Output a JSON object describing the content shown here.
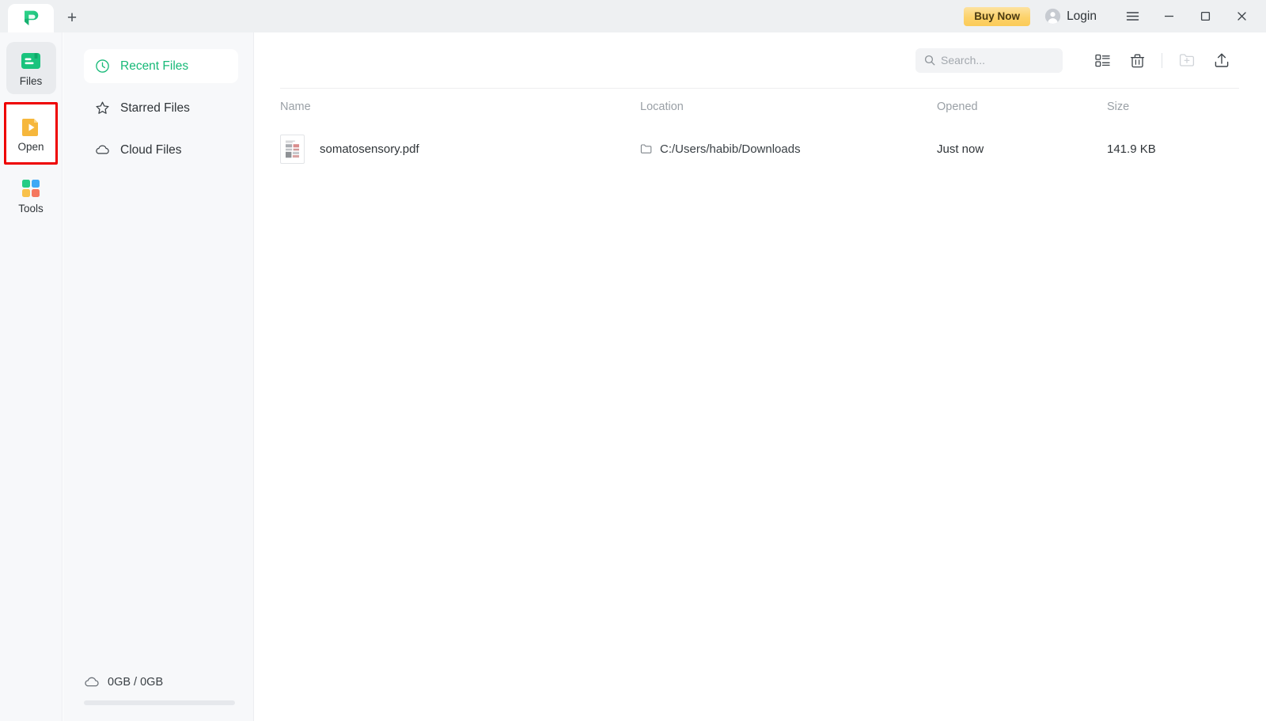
{
  "window": {
    "tab_logo": "pdfelement-logo-icon",
    "new_tab_label": "+",
    "buy_now_label": "Buy Now",
    "login_label": "Login",
    "menu_icon": "hamburger-menu-icon",
    "minimize_icon": "minimize-icon",
    "maximize_icon": "maximize-icon",
    "close_icon": "close-icon"
  },
  "rail": {
    "items": [
      {
        "label": "Files",
        "icon": "files-icon",
        "state": "active"
      },
      {
        "label": "Open",
        "icon": "open-icon",
        "state": "highlighted"
      },
      {
        "label": "Tools",
        "icon": "tools-grid-icon",
        "state": "normal"
      }
    ]
  },
  "sidebar": {
    "items": [
      {
        "label": "Recent Files",
        "icon": "clock-icon",
        "state": "active"
      },
      {
        "label": "Starred Files",
        "icon": "star-icon",
        "state": "normal"
      },
      {
        "label": "Cloud Files",
        "icon": "cloud-icon",
        "state": "normal"
      }
    ],
    "storage": {
      "icon": "cloud-icon",
      "text": "0GB / 0GB",
      "used_percent": 0
    }
  },
  "toolbar": {
    "search_placeholder": "Search...",
    "search_value": "",
    "buttons": [
      {
        "name": "list-view-icon",
        "enabled": true
      },
      {
        "name": "trash-icon",
        "enabled": true
      },
      {
        "name": "new-folder-icon",
        "enabled": false
      },
      {
        "name": "upload-icon",
        "enabled": true
      }
    ]
  },
  "table": {
    "columns": [
      "Name",
      "Location",
      "Opened",
      "Size"
    ],
    "rows": [
      {
        "name": "somatosensory.pdf",
        "location": "C:/Users/habib/Downloads",
        "opened": "Just now",
        "size": "141.9 KB",
        "thumbnail": "pdf-document-thumbnail"
      }
    ]
  },
  "colors": {
    "brand_green": "#17b978",
    "buy_now_gold": "#fbcb58",
    "highlight_red": "#ee0000",
    "titlebar_bg": "#eef0f2",
    "sidebar_bg": "#f7f8fa"
  }
}
